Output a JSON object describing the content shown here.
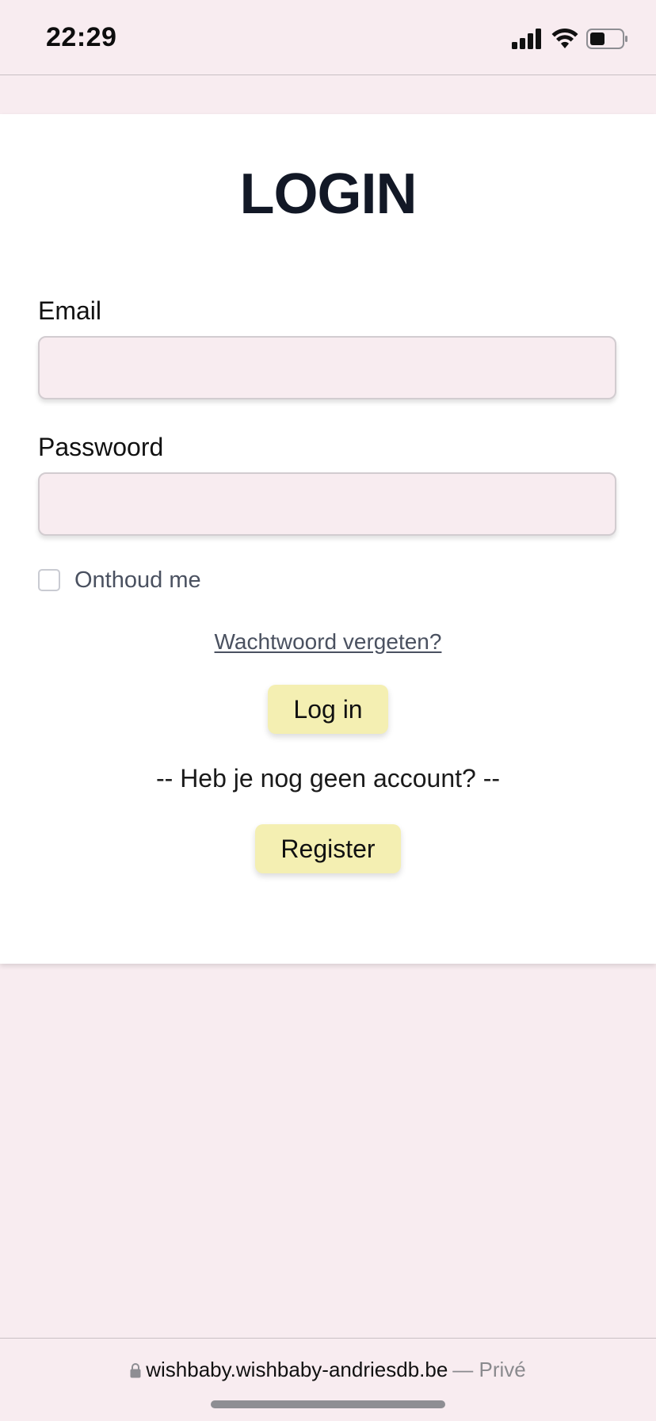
{
  "status_bar": {
    "time": "22:29",
    "icons": [
      "cellular-signal-icon",
      "wifi-icon",
      "battery-icon"
    ]
  },
  "login": {
    "title": "LOGIN",
    "email_label": "Email",
    "email_value": "",
    "password_label": "Passwoord",
    "password_value": "",
    "remember_label": "Onthoud me",
    "remember_checked": false,
    "forgot_link": "Wachtwoord vergeten?",
    "login_button": "Log in",
    "no_account_text": "-- Heb je nog geen account? --",
    "register_button": "Register"
  },
  "browser": {
    "url": "wishbaby.wishbaby-andriesdb.be",
    "private_label": "— Privé",
    "lock_icon": "lock-icon"
  },
  "colors": {
    "page_background": "#f8ecf0",
    "card_background": "#ffffff",
    "button_background": "#f4efb2",
    "title_color": "#121826"
  }
}
